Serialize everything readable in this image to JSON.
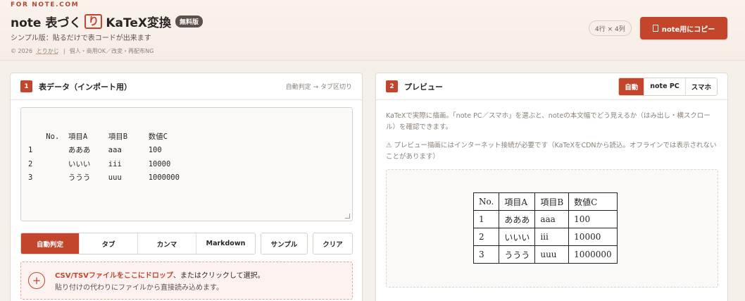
{
  "header": {
    "kicker": "FOR NOTE.COM",
    "title_pre": "note 表づく",
    "title_boxed": "り",
    "title_post": "KaTeX変換",
    "badge": "無料版",
    "subtitle": "シンプル版：貼るだけで表コードが出来ます",
    "copyright": "© 2026",
    "author": "とりかじ",
    "separator": "|",
    "license": "個人・商用OK／改変・再配布NG",
    "counter": "4行 × 4列",
    "copy_label": "note用にコピー"
  },
  "input_panel": {
    "num": "1",
    "title": "表データ（インポート用）",
    "hint": "自動判定 → タブ区切り",
    "text": "No.\t項目A\t項目B\t数値C\n1\tあああ\taaa\t100\n2\tいいい\tiii\t10000\n3\tううう\tuuu\t1000000",
    "formats": [
      "自動判定",
      "タブ",
      "カンマ",
      "Markdown"
    ],
    "active_format": 0,
    "sample_label": "サンプル",
    "clear_label": "クリア",
    "drop_bold": "CSV/TSVファイルをここにドロップ",
    "drop_rest": "、またはクリックして選択。",
    "drop_line2": "貼り付けの代わりにファイルから直接読み込めます。"
  },
  "preview_panel": {
    "num": "2",
    "title": "プレビュー",
    "modes": [
      "自動",
      "note PC",
      "スマホ"
    ],
    "active_mode": 0,
    "desc": "KaTeXで実際に描画。「note PC／スマホ」を選ぶと、noteの本文幅でどう見えるか（はみ出し・横スクロール）を確認できます。",
    "warn": "⚠ プレビュー描画にはインターネット接続が必要です（KaTeXをCDNから読込。オフラインでは表示されないことがあります）",
    "table": [
      [
        "No.",
        "項目A",
        "項目B",
        "数値C"
      ],
      [
        "1",
        "あああ",
        "aaa",
        "100"
      ],
      [
        "2",
        "いいい",
        "iii",
        "10000"
      ],
      [
        "3",
        "ううう",
        "uuu",
        "1000000"
      ]
    ]
  }
}
